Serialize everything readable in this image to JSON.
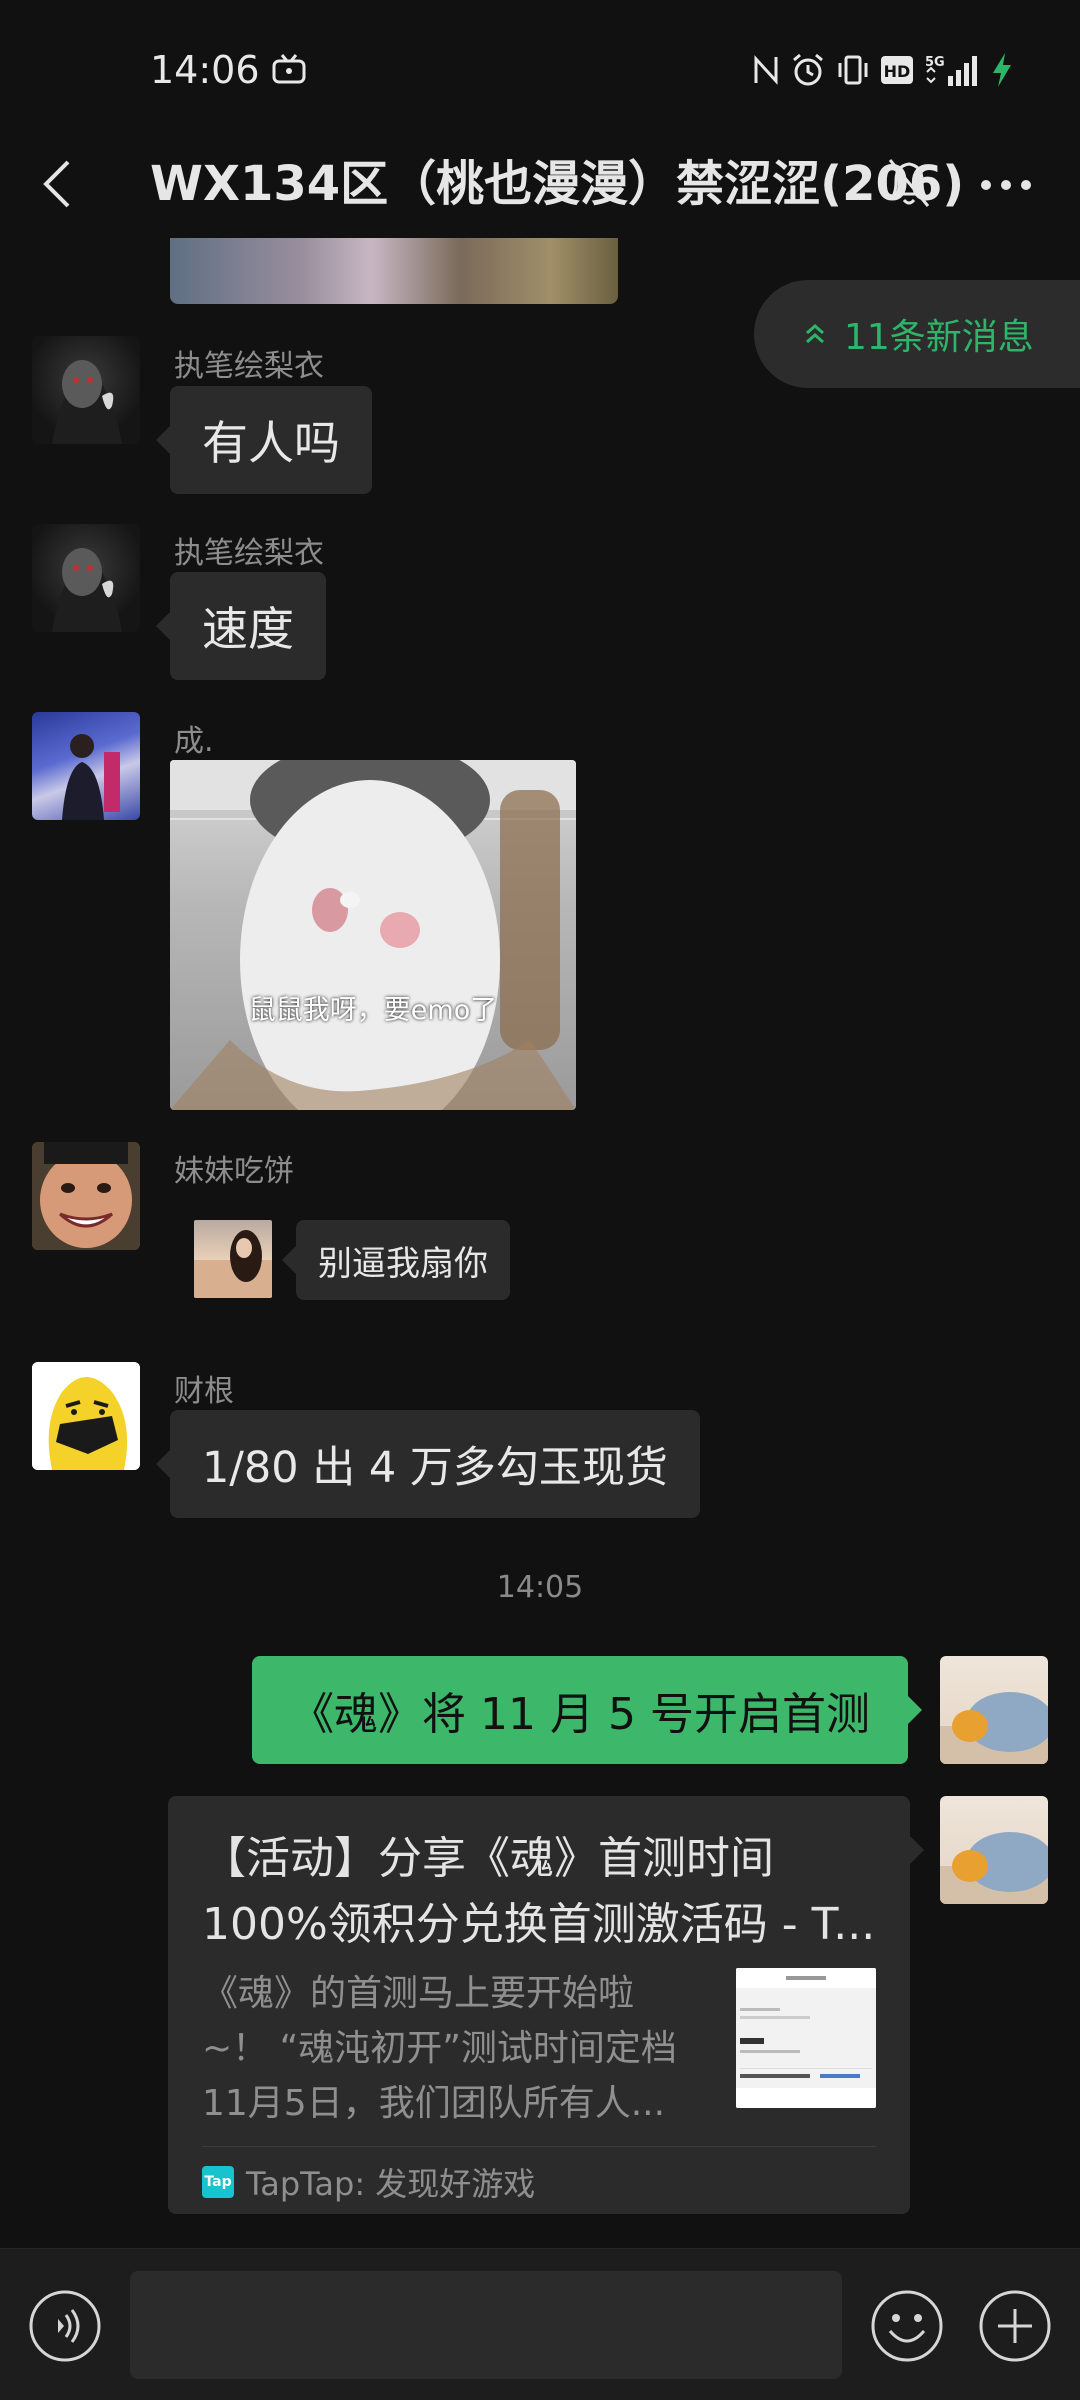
{
  "status_bar": {
    "time": "14:06",
    "network": "5G",
    "hd_badge": "HD"
  },
  "header": {
    "title": "WX134区（桃也漫漫）禁涩涩(206)"
  },
  "new_messages": {
    "label": "11条新消息"
  },
  "messages": [
    {
      "sender": "执笔绘梨衣",
      "text": "有人吗"
    },
    {
      "sender": "执笔绘梨衣",
      "text": "速度"
    },
    {
      "sender": "成.",
      "image_caption": "鼠鼠我呀，要emo了"
    },
    {
      "sender": "妹妹吃饼",
      "text": "别逼我扇你"
    },
    {
      "sender": "财根",
      "text": "1/80 出 4 万多勾玉现货"
    }
  ],
  "timestamp": "14:05",
  "my_messages": {
    "text": "《魂》将 11 月 5 号开启首测",
    "card": {
      "title_line1": "【活动】分享《魂》首测时间",
      "title_line2": "100%领积分兑换首测激活码 - T...",
      "desc_line1": "《魂》的首测马上要开始啦",
      "desc_line2": "~！ “魂沌初开”测试时间定档",
      "desc_line3": "11月5日，我们团队所有人...",
      "source": "TapTap: 发现好游戏",
      "source_logo": "Tap"
    }
  },
  "colors": {
    "background": "#111111",
    "bubble": "#2b2b2b",
    "my_bubble": "#3db86b",
    "accent_green": "#2db56a"
  }
}
